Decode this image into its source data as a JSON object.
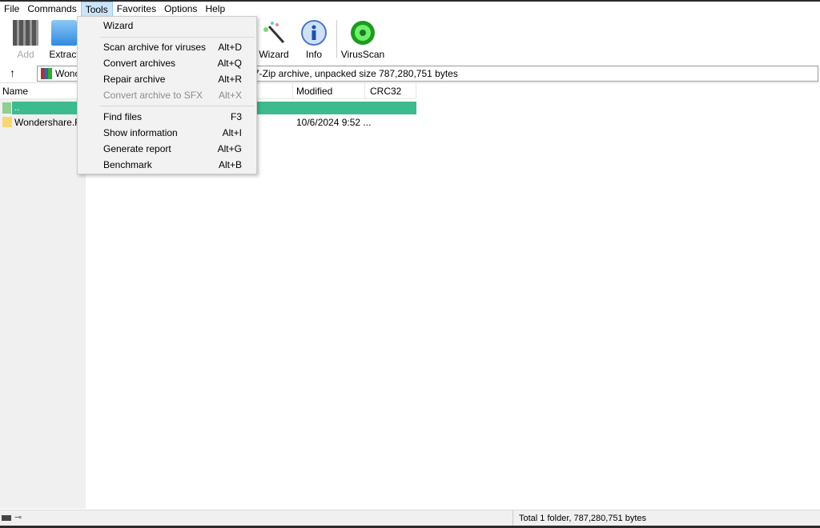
{
  "menubar": [
    "File",
    "Commands",
    "Tools",
    "Favorites",
    "Options",
    "Help"
  ],
  "toolbar": {
    "add": "Add",
    "extract": "Extract",
    "wizard": "Wizard",
    "info": "Info",
    "virusscan": "VirusScan"
  },
  "address": {
    "left": "Wonc",
    "right": "7-Zip archive, unpacked size 787,280,751 bytes"
  },
  "columns": {
    "name": "Name",
    "modified": "Modified",
    "crc": "CRC32"
  },
  "rows": [
    {
      "name": "..",
      "modified": ""
    },
    {
      "name": "Wondershare.Fil",
      "modified": "10/6/2024 9:52 ..."
    }
  ],
  "tools_menu": [
    {
      "label": "Wizard",
      "shortcut": ""
    },
    {
      "label": "Scan archive for viruses",
      "shortcut": "Alt+D"
    },
    {
      "label": "Convert archives",
      "shortcut": "Alt+Q"
    },
    {
      "label": "Repair archive",
      "shortcut": "Alt+R"
    },
    {
      "label": "Convert archive to SFX",
      "shortcut": "Alt+X",
      "disabled": true
    },
    {
      "label": "Find files",
      "shortcut": "F3"
    },
    {
      "label": "Show information",
      "shortcut": "Alt+I"
    },
    {
      "label": "Generate report",
      "shortcut": "Alt+G"
    },
    {
      "label": "Benchmark",
      "shortcut": "Alt+B"
    }
  ],
  "status": "Total 1 folder, 787,280,751 bytes",
  "colors": {
    "selected_row": "#3dbb8e",
    "menu_bg": "#f2f2f2"
  }
}
